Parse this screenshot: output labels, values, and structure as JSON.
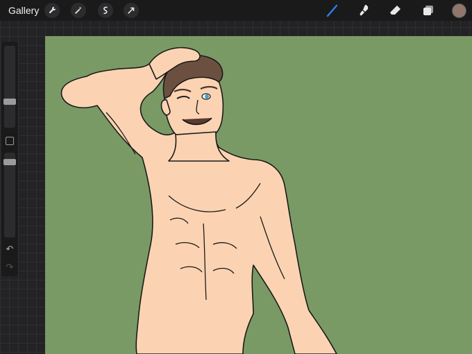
{
  "topbar": {
    "gallery_label": "Gallery",
    "left_tools": [
      "wrench-icon",
      "magic-wand-icon",
      "selection-icon",
      "transform-arrow-icon"
    ],
    "right_tools": [
      "brush-icon",
      "smudge-icon",
      "eraser-icon",
      "layers-icon"
    ],
    "active_tool": "brush-icon",
    "active_color": "#8f776c",
    "accent": "#2f7fe8"
  },
  "sidebar": {
    "brush_size_level": 0.32,
    "opacity_level": 0.08,
    "undo_icon": "undo-icon",
    "redo_icon": "redo-icon"
  },
  "canvas": {
    "background_color": "#7a9a65",
    "skin_color": "#fbd3b2",
    "hair_color": "#6b5040",
    "eye_color": "#4aa0c8"
  }
}
